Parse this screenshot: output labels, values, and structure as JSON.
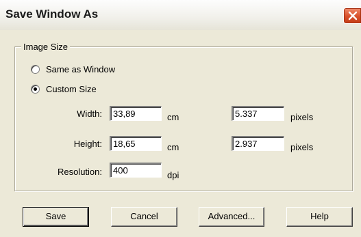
{
  "window": {
    "title": "Save Window As"
  },
  "image_size": {
    "legend": "Image Size",
    "options": [
      {
        "label": "Same as Window",
        "checked": false
      },
      {
        "label": "Custom Size",
        "checked": true
      }
    ],
    "width": {
      "label": "Width:",
      "value": "33,89",
      "unit": "cm",
      "pixels_value": "5.337",
      "pixels_unit": "pixels"
    },
    "height": {
      "label": "Height:",
      "value": "18,65",
      "unit": "cm",
      "pixels_value": "2.937",
      "pixels_unit": "pixels"
    },
    "resolution": {
      "label": "Resolution:",
      "value": "400",
      "unit": "dpi"
    }
  },
  "buttons": {
    "save": "Save",
    "cancel": "Cancel",
    "advanced": "Advanced...",
    "help": "Help"
  },
  "colors": {
    "face": "#ece9d8",
    "close_button": "#d8502a"
  }
}
